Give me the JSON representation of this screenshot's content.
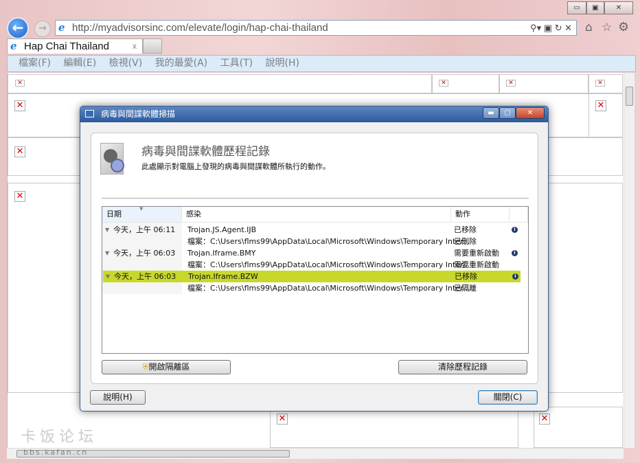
{
  "browser": {
    "url": "http://myadvisorsinc.com/elevate/login/hap-chai-thailand",
    "tab_title": "Hap Chai Thailand",
    "tab_close": "x",
    "menu": [
      "檔案(F)",
      "編輯(E)",
      "檢視(V)",
      "我的最愛(A)",
      "工具(T)",
      "說明(H)"
    ]
  },
  "dialog": {
    "window_title": "病毒與間諜軟體掃描",
    "heading": "病毒與間諜軟體歷程記錄",
    "description": "此處顯示對電腦上發現的病毒與間諜軟體所執行的動作。",
    "columns": [
      "日期",
      "感染",
      "動作"
    ],
    "entries": [
      {
        "date": "今天，上午 06:11",
        "name": "Trojan.JS.Agent.IJB",
        "action": "已移除",
        "file": "檔案：C:\\Users\\flms99\\AppData\\Local\\Microsoft\\Windows\\Temporary Inter...",
        "file_action": "已刪除",
        "selected": false
      },
      {
        "date": "今天，上午 06:03",
        "name": "Trojan.Iframe.BMY",
        "action": "需要重新啟動",
        "file": "檔案：C:\\Users\\flms99\\AppData\\Local\\Microsoft\\Windows\\Temporary Inter...",
        "file_action": "需要重新啟動",
        "selected": false
      },
      {
        "date": "今天，上午 06:03",
        "name": "Trojan.Iframe.BZW",
        "action": "已移除",
        "file": "檔案：C:\\Users\\flms99\\AppData\\Local\\Microsoft\\Windows\\Temporary Inter...",
        "file_action": "已隔離",
        "selected": true
      }
    ],
    "open_quarantine": "開啟隔離區",
    "clear_history": "清除歷程記錄",
    "help": "說明(H)",
    "close": "關閉(C)"
  },
  "watermark": {
    "line1": "卡饭论坛",
    "line2": "bbs.kafan.cn"
  },
  "colors": {
    "selected_row": "#c8d82a",
    "titlebar": "#2c5a9e"
  }
}
